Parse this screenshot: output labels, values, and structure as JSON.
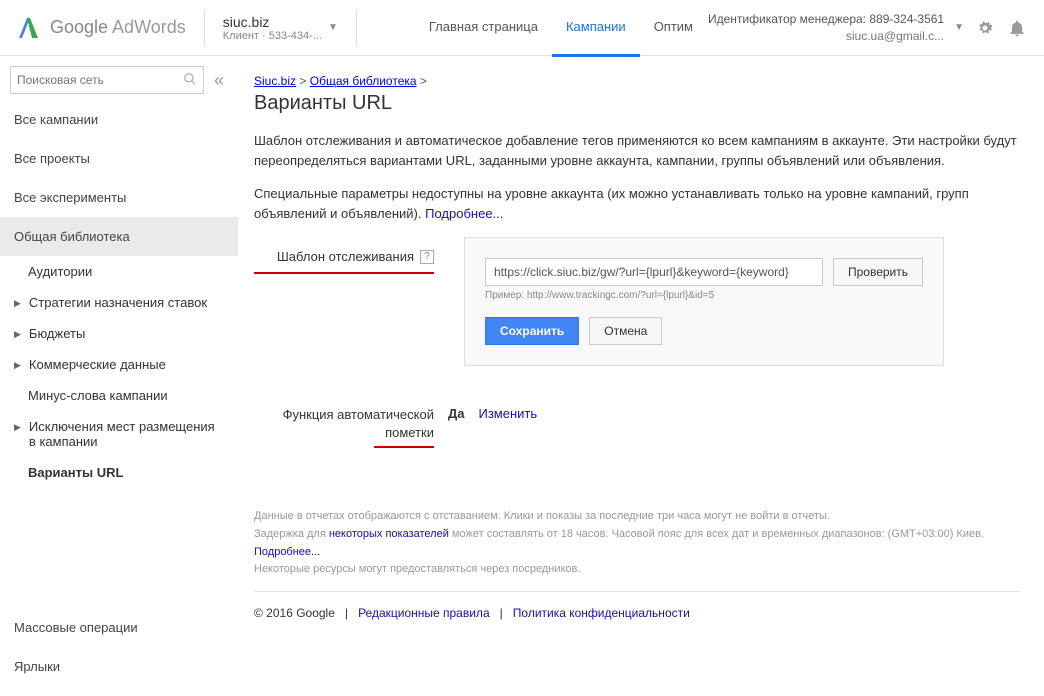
{
  "header": {
    "logo_google": "Google",
    "logo_adwords": "AdWords",
    "client_name": "siuc.biz",
    "client_label": "Клиент",
    "client_id": "533-434-...",
    "manager_label": "Идентификатор менеджера:",
    "manager_id": "889-324-3561",
    "manager_email": "siuc.ua@gmail.c..."
  },
  "nav": {
    "home": "Главная страница",
    "campaigns": "Кампании",
    "optim": "Оптим"
  },
  "sidebar": {
    "search_placeholder": "Поисковая сеть",
    "all_campaigns": "Все кампании",
    "all_projects": "Все проекты",
    "all_experiments": "Все эксперименты",
    "shared_library": "Общая библиотека",
    "items": [
      {
        "label": "Аудитории",
        "caret": false
      },
      {
        "label": "Стратегии назначения ставок",
        "caret": true
      },
      {
        "label": "Бюджеты",
        "caret": true
      },
      {
        "label": "Коммерческие данные",
        "caret": true
      },
      {
        "label": "Минус-слова кампании",
        "caret": false
      },
      {
        "label": "Исключения мест размещения в кампании",
        "caret": true
      },
      {
        "label": "Варианты URL",
        "caret": false,
        "bold": true
      }
    ],
    "bulk_ops": "Массовые операции",
    "labels": "Ярлыки"
  },
  "breadcrumb": {
    "b1": "Siuc.biz",
    "b2": "Общая библиотека",
    "sep": ">"
  },
  "page_title": "Варианты URL",
  "desc1": "Шаблон отслеживания и автоматическое добавление тегов применяются ко всем кампаниям в аккаунте. Эти настройки будут переопределяться вариантами URL, заданными уровне аккаунта, кампании, группы объявлений или объявления.",
  "desc2": "Специальные параметры недоступны на уровне аккаунта (их можно устанавливать только на уровне кампаний, групп объявлений и объявлений).",
  "more_link": "Подробнее...",
  "tracking": {
    "label": "Шаблон отслеживания",
    "input_value": "https://click.siuc.biz/gw/?url={lpurl}&keyword={keyword}",
    "check_btn": "Проверить",
    "example": "Пример: http://www.trackingc.com/?url={lpurl}&id=5",
    "save_btn": "Сохранить",
    "cancel_btn": "Отмена"
  },
  "auto_tag": {
    "label": "Функция автоматической пометки",
    "value": "Да",
    "change": "Изменить"
  },
  "notes": {
    "line1": "Данные в отчетах отображаются с отставанием. Клики и показы за последние три часа могут не войти в отчеты.",
    "line2a": "Задержка для ",
    "line2_link": "некоторых показателей",
    "line2b": " может составлять от 18 часов. Часовой пояс для всех дат и временных диапазонов: (GMT+03:00) Киев.",
    "line3_link": "Подробнее...",
    "line4": "Некоторые ресурсы могут предоставляться через посредников."
  },
  "footer": {
    "copyright": "© 2016 Google",
    "sep": "|",
    "editorial": "Редакционные правила",
    "privacy": "Политика конфиденциальности"
  }
}
